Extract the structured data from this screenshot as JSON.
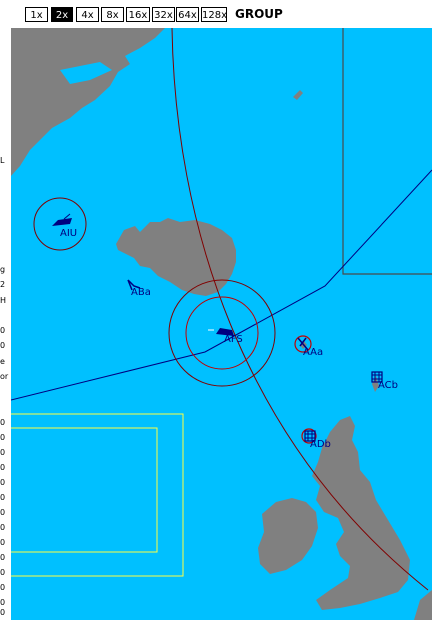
{
  "toolbar": {
    "zoom_levels": [
      "1x",
      "2x",
      "4x",
      "8x",
      "16x",
      "32x",
      "64x",
      "128x"
    ],
    "selected_zoom": "2x",
    "mode_label": "GROUP"
  },
  "left_edge_fragments": [
    "L",
    "g",
    "2",
    "H",
    "0",
    "0",
    "e",
    "or",
    "0",
    "0",
    "0",
    "0",
    "0",
    "0",
    "0",
    "0",
    "0",
    "0",
    "0",
    "0",
    "0",
    "0",
    "0"
  ],
  "map": {
    "sea_color": "#00c0ff",
    "land_color": "#808080",
    "units": [
      {
        "id": "AIU",
        "label": "AIU"
      },
      {
        "id": "ABa",
        "label": "ABa"
      },
      {
        "id": "AFS",
        "label": "AFS"
      },
      {
        "id": "AAa",
        "label": "AAa"
      },
      {
        "id": "ACb",
        "label": "ACb"
      },
      {
        "id": "ADb",
        "label": "ADb"
      }
    ]
  }
}
